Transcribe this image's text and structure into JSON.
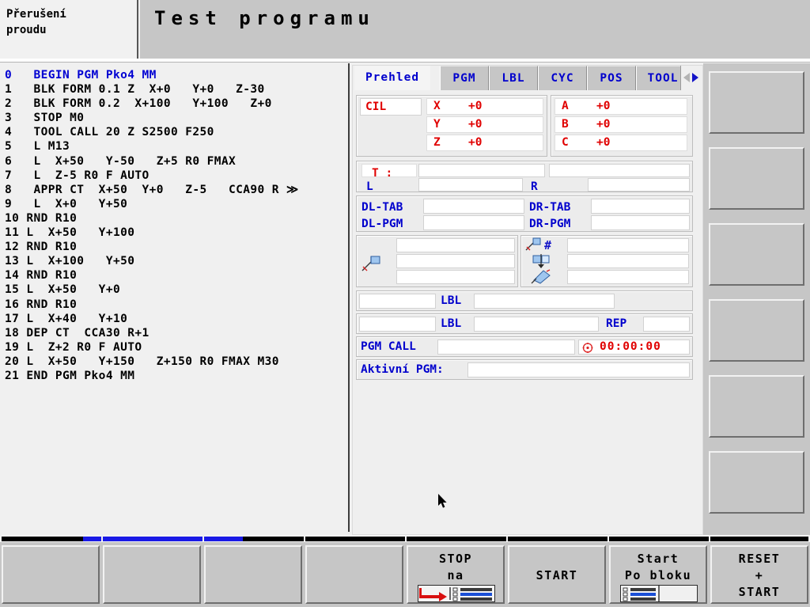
{
  "header": {
    "status_text": "Přerušení\nproudu",
    "mode_title": "Test programu"
  },
  "program": {
    "lines": [
      "0   BEGIN PGM Pko4 MM",
      "1   BLK FORM 0.1 Z  X+0   Y+0   Z-30",
      "2   BLK FORM 0.2  X+100   Y+100   Z+0",
      "3   STOP M0",
      "4   TOOL CALL 20 Z S2500 F250",
      "5   L M13",
      "6   L  X+50   Y-50   Z+5 R0 FMAX",
      "7   L  Z-5 R0 F AUTO",
      "8   APPR CT  X+50  Y+0   Z-5   CCA90 R ≫",
      "9   L  X+0   Y+50",
      "10 RND R10",
      "11 L  X+50   Y+100",
      "12 RND R10",
      "13 L  X+100   Y+50",
      "14 RND R10",
      "15 L  X+50   Y+0",
      "16 RND R10",
      "17 L  X+40   Y+10",
      "18 DEP CT  CCA30 R+1",
      "19 L  Z+2 R0 F AUTO",
      "20 L  X+50   Y+150   Z+150 R0 FMAX M30",
      "21 END PGM Pko4 MM"
    ]
  },
  "info_panel": {
    "tabs": [
      {
        "label": "Prehled",
        "active": true
      },
      {
        "label": "PGM",
        "active": false
      },
      {
        "label": "LBL",
        "active": false
      },
      {
        "label": "CYC",
        "active": false
      },
      {
        "label": "POS",
        "active": false
      },
      {
        "label": "TOOL",
        "active": false
      }
    ],
    "tab_nav": {
      "prev_icon": "chevron-left-icon",
      "next_icon": "chevron-right-icon"
    },
    "datum": {
      "label": "CIL",
      "axes_left": [
        {
          "name": "X",
          "value": "+0"
        },
        {
          "name": "Y",
          "value": "+0"
        },
        {
          "name": "Z",
          "value": "+0"
        }
      ],
      "axes_right": [
        {
          "name": "A",
          "value": "+0"
        },
        {
          "name": "B",
          "value": "+0"
        },
        {
          "name": "C",
          "value": "+0"
        }
      ]
    },
    "tool": {
      "t_label": "T :",
      "t_value": "",
      "t_name": "",
      "l_label": "L",
      "l_value": "",
      "r_label": "R",
      "r_value": "",
      "dl_tab_label": "DL-TAB",
      "dl_tab_value": "",
      "dr_tab_label": "DR-TAB",
      "dr_tab_value": "",
      "dl_pgm_label": "DL-PGM",
      "dl_pgm_value": "",
      "dr_pgm_label": "DR-PGM",
      "dr_pgm_value": ""
    },
    "transform": {
      "left_icon": "datum-shift-icon",
      "left_values": [
        "",
        "",
        ""
      ],
      "right_rows": [
        {
          "icon": "datum-number-icon",
          "value": ""
        },
        {
          "icon": "mirror-icon",
          "value": ""
        },
        {
          "icon": "rotation-icon",
          "value": ""
        }
      ]
    },
    "labels": {
      "lbl1_name": "LBL",
      "lbl1_value_left": "",
      "lbl1_value_right": "",
      "lbl2_name": "LBL",
      "lbl2_value_left": "",
      "lbl2_value_right": "",
      "rep_label": "REP",
      "rep_value": ""
    },
    "pgm_call": {
      "label": "PGM CALL",
      "value": "",
      "timer_icon": "stopwatch-icon",
      "timer_value": "00:00:00"
    },
    "active_pgm": {
      "label": "Aktivní PGM:",
      "value": ""
    }
  },
  "vertical_softkeys": [
    {
      "label": ""
    },
    {
      "label": ""
    },
    {
      "label": ""
    },
    {
      "label": ""
    },
    {
      "label": ""
    },
    {
      "label": ""
    }
  ],
  "bottom_softkeys": [
    {
      "line1": "",
      "line2": "",
      "line3": "",
      "icon": ""
    },
    {
      "line1": "",
      "line2": "",
      "line3": "",
      "icon": ""
    },
    {
      "line1": "",
      "line2": "",
      "line3": "",
      "icon": ""
    },
    {
      "line1": "",
      "line2": "",
      "line3": "",
      "icon": ""
    },
    {
      "line1": "STOP",
      "line2": "na",
      "line3": "",
      "icon": "stop-at-block-icon"
    },
    {
      "line1": "",
      "line2": "START",
      "line3": "",
      "icon": ""
    },
    {
      "line1": "Start",
      "line2": "Po bloku",
      "line3": "",
      "icon": "single-block-icon"
    },
    {
      "line1": "RESET",
      "line2": "+",
      "line3": "START",
      "icon": ""
    }
  ],
  "progress_bar": {
    "fill_percent": 20,
    "fill_color": "#1a1ae6",
    "track_color": "#000000"
  },
  "status_icon": {
    "name": "pocket-calculator-icon",
    "color": "#cc00aa"
  }
}
